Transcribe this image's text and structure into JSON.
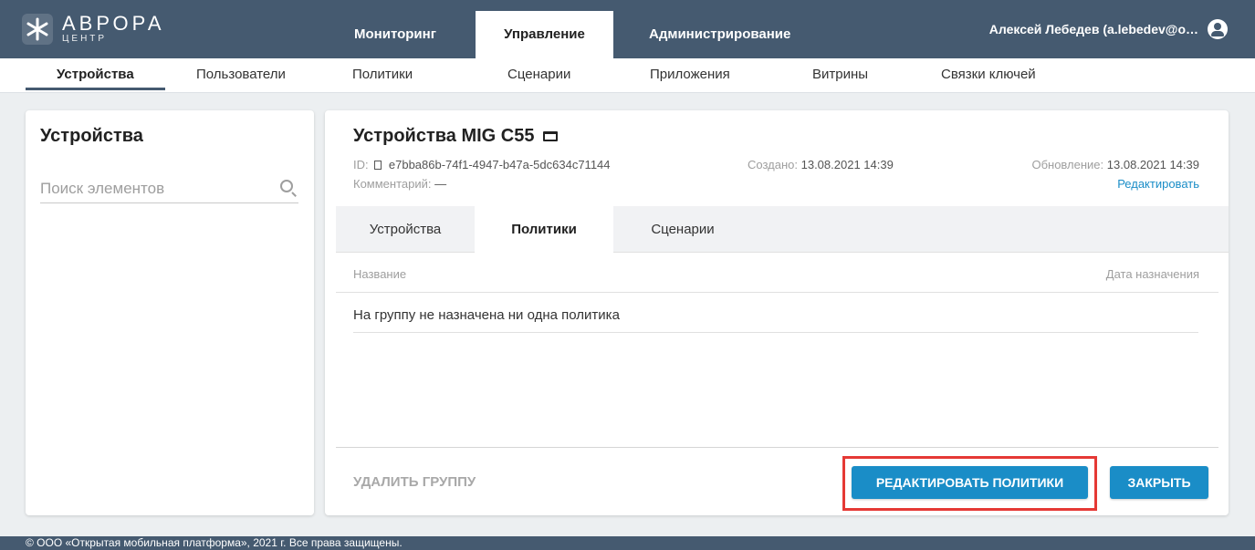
{
  "brand": {
    "name": "АВРОРА",
    "subtitle": "ЦЕНТР"
  },
  "main_nav": {
    "items": [
      {
        "label": "Мониторинг",
        "active": false
      },
      {
        "label": "Управление",
        "active": true
      },
      {
        "label": "Администрирование",
        "active": false
      }
    ]
  },
  "user": {
    "name": "Алексей Лебедев (a.lebedev@o…",
    "icon": "account-circle-icon"
  },
  "sub_nav": {
    "items": [
      {
        "label": "Устройства",
        "active": true
      },
      {
        "label": "Пользователи",
        "active": false
      },
      {
        "label": "Политики",
        "active": false
      },
      {
        "label": "Сценарии",
        "active": false
      },
      {
        "label": "Приложения",
        "active": false
      },
      {
        "label": "Витрины",
        "active": false
      },
      {
        "label": "Связки ключей",
        "active": false
      }
    ]
  },
  "sidebar": {
    "title": "Устройства",
    "search_placeholder": "Поиск элементов",
    "search_icon": "search-icon"
  },
  "group": {
    "title": "Устройства MIG C55",
    "title_icon": "folder-icon",
    "id_label": "ID:",
    "id_value": "e7bba86b-74f1-4947-b47a-5dc634c71144",
    "comment_label": "Комментарий:",
    "comment_value": "—",
    "created_label": "Создано:",
    "created_value": "13.08.2021 14:39",
    "updated_label": "Обновление:",
    "updated_value": "13.08.2021 14:39",
    "edit_link": "Редактировать"
  },
  "tabs": [
    {
      "label": "Устройства",
      "active": false
    },
    {
      "label": "Политики",
      "active": true
    },
    {
      "label": "Сценарии",
      "active": false
    }
  ],
  "table": {
    "columns": [
      "Название",
      "Дата назначения"
    ],
    "empty_message": "На группу не назначена ни одна политика"
  },
  "actions": {
    "delete_label": "Удалить группу",
    "edit_policies_label": "Редактировать политики",
    "close_label": "Закрыть"
  },
  "footer": {
    "text": "© ООО «Открытая мобильная платформа», 2021 г. Все права защищены."
  },
  "colors": {
    "navbar": "#455a70",
    "accent": "#1a8dc7",
    "highlight": "#e53935",
    "background": "#eceff1"
  }
}
